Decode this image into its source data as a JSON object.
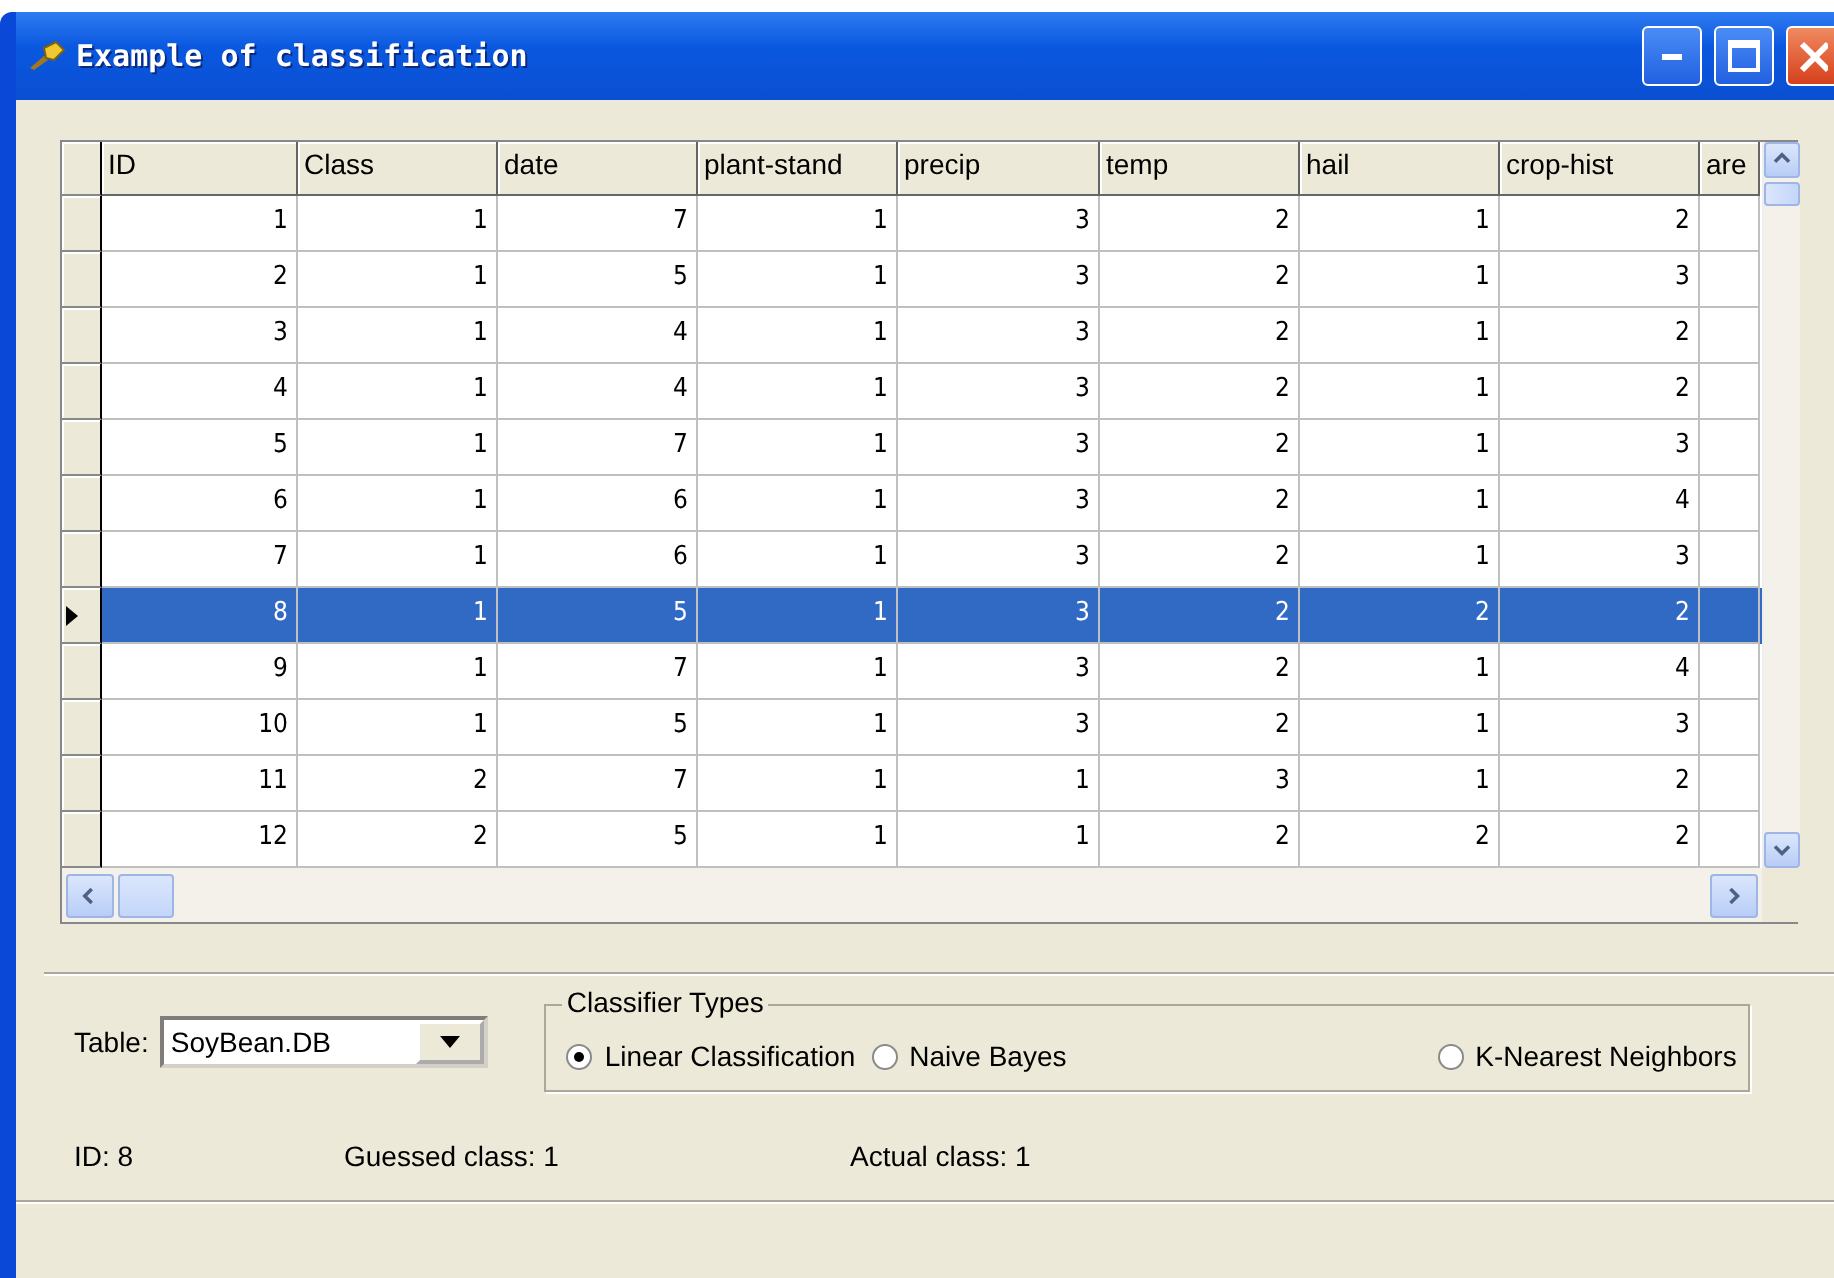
{
  "window": {
    "title": "Example of classification"
  },
  "table": {
    "columns": [
      "ID",
      "Class",
      "date",
      "plant-stand",
      "precip",
      "temp",
      "hail",
      "crop-hist",
      "are"
    ],
    "rows": [
      {
        "cells": [
          "1",
          "1",
          "7",
          "1",
          "3",
          "2",
          "1",
          "2"
        ],
        "selected": false
      },
      {
        "cells": [
          "2",
          "1",
          "5",
          "1",
          "3",
          "2",
          "1",
          "3"
        ],
        "selected": false
      },
      {
        "cells": [
          "3",
          "1",
          "4",
          "1",
          "3",
          "2",
          "1",
          "2"
        ],
        "selected": false
      },
      {
        "cells": [
          "4",
          "1",
          "4",
          "1",
          "3",
          "2",
          "1",
          "2"
        ],
        "selected": false
      },
      {
        "cells": [
          "5",
          "1",
          "7",
          "1",
          "3",
          "2",
          "1",
          "3"
        ],
        "selected": false
      },
      {
        "cells": [
          "6",
          "1",
          "6",
          "1",
          "3",
          "2",
          "1",
          "4"
        ],
        "selected": false
      },
      {
        "cells": [
          "7",
          "1",
          "6",
          "1",
          "3",
          "2",
          "1",
          "3"
        ],
        "selected": false
      },
      {
        "cells": [
          "8",
          "1",
          "5",
          "1",
          "3",
          "2",
          "2",
          "2"
        ],
        "selected": true
      },
      {
        "cells": [
          "9",
          "1",
          "7",
          "1",
          "3",
          "2",
          "1",
          "4"
        ],
        "selected": false
      },
      {
        "cells": [
          "10",
          "1",
          "5",
          "1",
          "3",
          "2",
          "1",
          "3"
        ],
        "selected": false
      },
      {
        "cells": [
          "11",
          "2",
          "7",
          "1",
          "1",
          "3",
          "1",
          "2"
        ],
        "selected": false
      },
      {
        "cells": [
          "12",
          "2",
          "5",
          "1",
          "1",
          "2",
          "2",
          "2"
        ],
        "selected": false
      }
    ]
  },
  "table_select": {
    "label": "Table:",
    "value": "SoyBean.DB"
  },
  "classifier_types": {
    "title": "Classifier Types",
    "options": [
      {
        "label": "Linear Classification",
        "selected": true
      },
      {
        "label": "Naive Bayes",
        "selected": false
      },
      {
        "label": "K-Nearest Neighbors",
        "selected": false
      }
    ]
  },
  "results": [
    "ID: 8",
    "Guessed class: 1",
    "Actual class: 1"
  ]
}
